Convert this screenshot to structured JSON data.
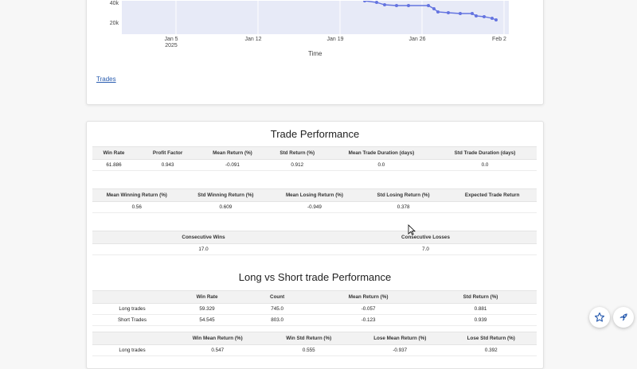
{
  "equity_chart": {
    "y_ticks": [
      "40k",
      "20k"
    ],
    "x_ticks": [
      {
        "label": "Jan 5",
        "sub": "2025"
      },
      {
        "label": "Jan 12",
        "sub": ""
      },
      {
        "label": "Jan 19",
        "sub": ""
      },
      {
        "label": "Jan 26",
        "sub": ""
      },
      {
        "label": "Feb 2",
        "sub": ""
      }
    ],
    "xlabel": "Time",
    "line_color": "#6474e0"
  },
  "trades_link": "Trades",
  "trade_performance": {
    "title": "Trade Performance",
    "table1": {
      "headers": [
        "Win Rate",
        "Profit Factor",
        "Mean Return (%)",
        "Std Return (%)",
        "Mean Trade Duration (days)",
        "Std Trade Duration (days)"
      ],
      "row": [
        "61.886",
        "0.943",
        "-0.091",
        "0.912",
        "0.0",
        "0.0"
      ]
    },
    "table2": {
      "headers": [
        "Mean Winning Return (%)",
        "Std Winning Return (%)",
        "Mean Losing Return (%)",
        "Std Losing Return (%)",
        "Expected Trade Return"
      ],
      "row": [
        "0.56",
        "0.609",
        "-0.949",
        "0.378",
        ""
      ]
    },
    "table3": {
      "headers": [
        "Consecutive Wins",
        "Consecutive Losses"
      ],
      "row": [
        "17.0",
        "7.0"
      ]
    }
  },
  "long_short": {
    "title": "Long vs Short trade Performance",
    "table1": {
      "headers": [
        "",
        "Win Rate",
        "Count",
        "Mean Return (%)",
        "Std Return (%)"
      ],
      "rows": [
        [
          "Long trades",
          "59.329",
          "745.0",
          "-0.057",
          "0.881"
        ],
        [
          "Short Trades",
          "54.545",
          "803.0",
          "-0.123",
          "0.939"
        ]
      ]
    },
    "table2": {
      "headers": [
        "",
        "Win Mean Return (%)",
        "Win Std Return (%)",
        "Lose Mean Return (%)",
        "Lose Std Return (%)"
      ],
      "rows": [
        [
          "Long trades",
          "0.547",
          "0.555",
          "-0.937",
          "0.392"
        ]
      ]
    }
  },
  "fabs": {
    "star_icon": "star-icon",
    "rocket_icon": "rocket-icon",
    "accent": "#2a5db0"
  }
}
